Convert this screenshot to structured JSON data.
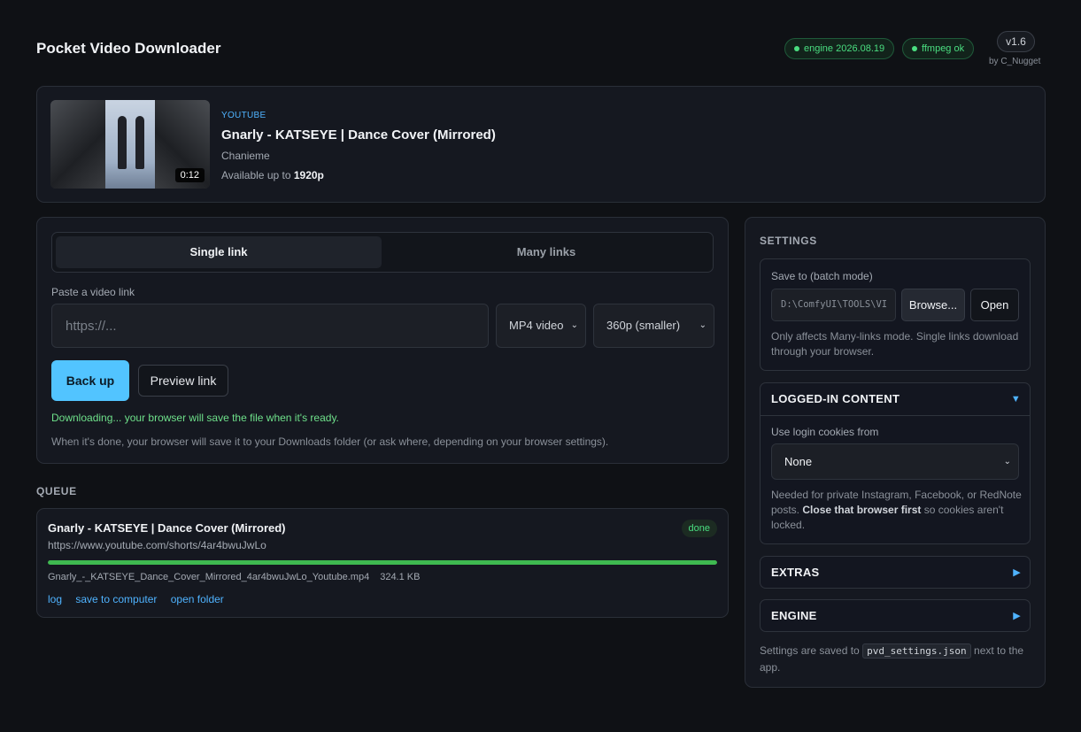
{
  "header": {
    "title": "Pocket Video Downloader",
    "engine_pill": "engine 2026.08.19",
    "ffmpeg_pill": "ffmpeg ok",
    "version": "v1.6",
    "byline": "by C_Nugget"
  },
  "video": {
    "source": "YOUTUBE",
    "title": "Gnarly - KATSEYE | Dance Cover (Mirrored)",
    "channel": "Chanieme",
    "available_prefix": "Available up to",
    "available_quality": "1920p",
    "duration": "0:12"
  },
  "download": {
    "tabs": [
      {
        "label": "Single link",
        "active": true
      },
      {
        "label": "Many links",
        "active": false
      }
    ],
    "link_label": "Paste a video link",
    "url_placeholder": "https://...",
    "url_value": "",
    "format_selected": "MP4 video",
    "quality_selected": "360p (smaller)",
    "primary_button": "Back up",
    "preview_button": "Preview link",
    "status": "Downloading... your browser will save the file when it's ready.",
    "hint": "When it's done, your browser will save it to your Downloads folder (or ask where, depending on your browser settings)."
  },
  "queue": {
    "heading": "QUEUE",
    "items": [
      {
        "title": "Gnarly - KATSEYE | Dance Cover (Mirrored)",
        "url": "https://www.youtube.com/shorts/4ar4bwuJwLo",
        "status": "done",
        "progress": 1.0,
        "filename": "Gnarly_-_KATSEYE_Dance_Cover_Mirrored_4ar4bwuJwLo_Youtube.mp4",
        "size": "324.1 KB",
        "links": [
          "log",
          "save to computer",
          "open folder"
        ]
      }
    ]
  },
  "settings": {
    "heading": "SETTINGS",
    "save_to_label": "Save to (batch mode)",
    "save_path": "D:\\ComfyUI\\TOOLS\\VI",
    "browse_button": "Browse...",
    "open_button": "Open",
    "save_note": "Only affects Many-links mode. Single links download through your browser.",
    "logged_in": {
      "heading": "LOGGED-IN CONTENT",
      "expanded": true,
      "cookies_label": "Use login cookies from",
      "cookies_selected": "None",
      "note_prefix": "Needed for private Instagram, Facebook, or RedNote posts.",
      "note_bold": "Close that browser first",
      "note_suffix": "so cookies aren't locked."
    },
    "extras_heading": "EXTRAS",
    "engine_heading": "ENGINE",
    "footer_prefix": "Settings are saved to",
    "footer_file": "pvd_settings.json",
    "footer_suffix": "next to the app."
  },
  "colors": {
    "background": "#0f1115",
    "accent": "#52c4ff",
    "link": "#4fb3ff",
    "success": "#4ade80"
  },
  "icons": {
    "expanded_arrow": "▼",
    "collapsed_arrow": "▶",
    "select_chevron": "⌄"
  }
}
